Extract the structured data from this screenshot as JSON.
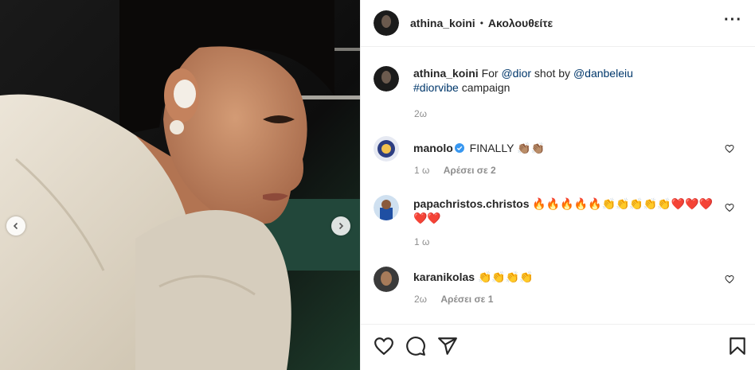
{
  "post": {
    "author": "athina_koini",
    "follow_status": "Ακολουθείτε",
    "caption": {
      "prefix": "For ",
      "mention1": "@dior",
      "middle": " shot by ",
      "mention2": "@danbeleiu",
      "hashtag": "#diorvibe",
      "suffix": " campaign"
    },
    "caption_time": "2ω"
  },
  "comments": [
    {
      "user": "manolo",
      "verified": true,
      "text": "FINALLY 👏🏽👏🏽",
      "time": "1 ω",
      "likes": "Αρέσει σε 2"
    },
    {
      "user": "papachristos.christos",
      "verified": false,
      "text": "🔥🔥🔥🔥🔥👏👏👏👏👏❤️❤️❤️❤️❤️",
      "time": "1 ω",
      "likes": ""
    },
    {
      "user": "karanikolas",
      "verified": false,
      "text": "👏👏👏👏",
      "time": "2ω",
      "likes": "Αρέσει σε 1"
    }
  ],
  "icons": {
    "like": "heart-icon",
    "comment": "comment-icon",
    "share": "send-icon",
    "save": "bookmark-icon",
    "prev": "chevron-left-icon",
    "next": "chevron-right-icon",
    "more": "more-icon"
  }
}
